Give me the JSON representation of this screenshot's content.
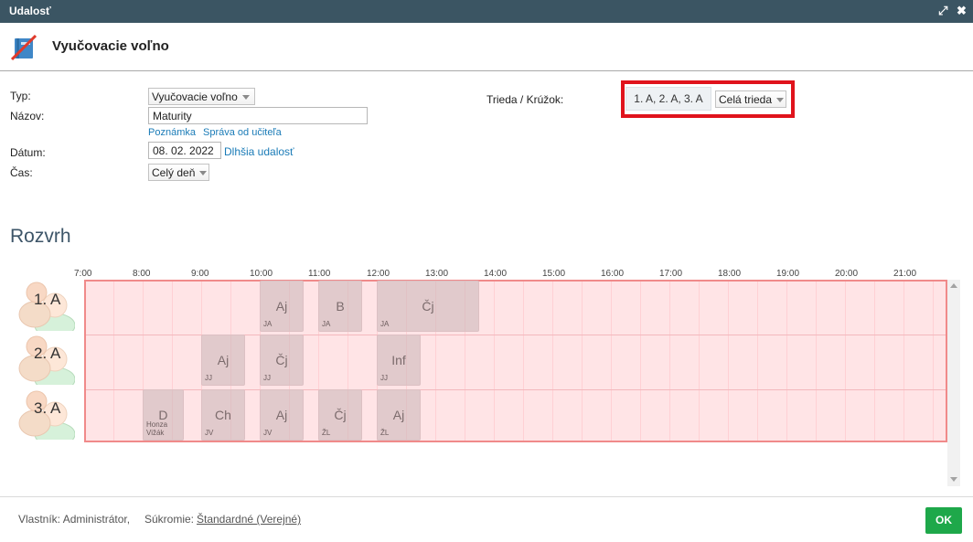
{
  "window": {
    "title": "Udalosť"
  },
  "header": {
    "heading": "Vyučovacie voľno"
  },
  "form": {
    "type_label": "Typ:",
    "type_value": "Vyučovacie voľno",
    "name_label": "Názov:",
    "name_value": "Maturity",
    "note_link": "Poznámka",
    "teacher_message_link": "Správa od učiteľa",
    "date_label": "Dátum:",
    "date_value": "08. 02. 2022",
    "longer_event_link": "Dlhšia udalosť",
    "time_label": "Čas:",
    "time_value": "Celý deň",
    "class_label": "Trieda / Krúžok:",
    "classes_value": "1. A, 2. A, 3. A",
    "group_value": "Celá trieda"
  },
  "schedule": {
    "title": "Rozvrh",
    "hours": [
      "7:00",
      "8:00",
      "9:00",
      "10:00",
      "11:00",
      "12:00",
      "13:00",
      "14:00",
      "15:00",
      "16:00",
      "17:00",
      "18:00",
      "19:00",
      "20:00",
      "21:00"
    ],
    "rows": [
      {
        "name": "1. A",
        "lessons": [
          {
            "subject": "Aj",
            "teacher": "JA",
            "start": 10.0,
            "end": 10.75
          },
          {
            "subject": "B",
            "teacher": "JA",
            "start": 11.0,
            "end": 11.75
          },
          {
            "subject": "Čj",
            "teacher": "JA",
            "start": 12.0,
            "end": 13.75
          }
        ]
      },
      {
        "name": "2. A",
        "lessons": [
          {
            "subject": "Aj",
            "teacher": "JJ",
            "start": 9.0,
            "end": 9.75
          },
          {
            "subject": "Čj",
            "teacher": "JJ",
            "start": 10.0,
            "end": 10.75
          },
          {
            "subject": "Inf",
            "teacher": "JJ",
            "start": 12.0,
            "end": 12.75
          }
        ]
      },
      {
        "name": "3. A",
        "lessons": [
          {
            "subject": "D",
            "teacher": "Honza Vižák",
            "start": 8.0,
            "end": 8.7
          },
          {
            "subject": "Ch",
            "teacher": "JV",
            "start": 9.0,
            "end": 9.75
          },
          {
            "subject": "Aj",
            "teacher": "JV",
            "start": 10.0,
            "end": 10.75
          },
          {
            "subject": "Čj",
            "teacher": "ŽL",
            "start": 11.0,
            "end": 11.75
          },
          {
            "subject": "Aj",
            "teacher": "ŽL",
            "start": 12.0,
            "end": 12.75
          }
        ]
      }
    ]
  },
  "footer": {
    "owner": "Vlastník: Administrátor,",
    "privacy_label": "Súkromie:",
    "privacy_value": "Štandardné (Verejné)",
    "ok_label": "OK"
  },
  "colors": {
    "titlebar": "#3b5563",
    "highlight": "#e0131c",
    "timeline_bg": "#ffe4e6",
    "timeline_border": "#f08a8a",
    "ok_button": "#1ea84a",
    "link": "#1a7bb7"
  }
}
